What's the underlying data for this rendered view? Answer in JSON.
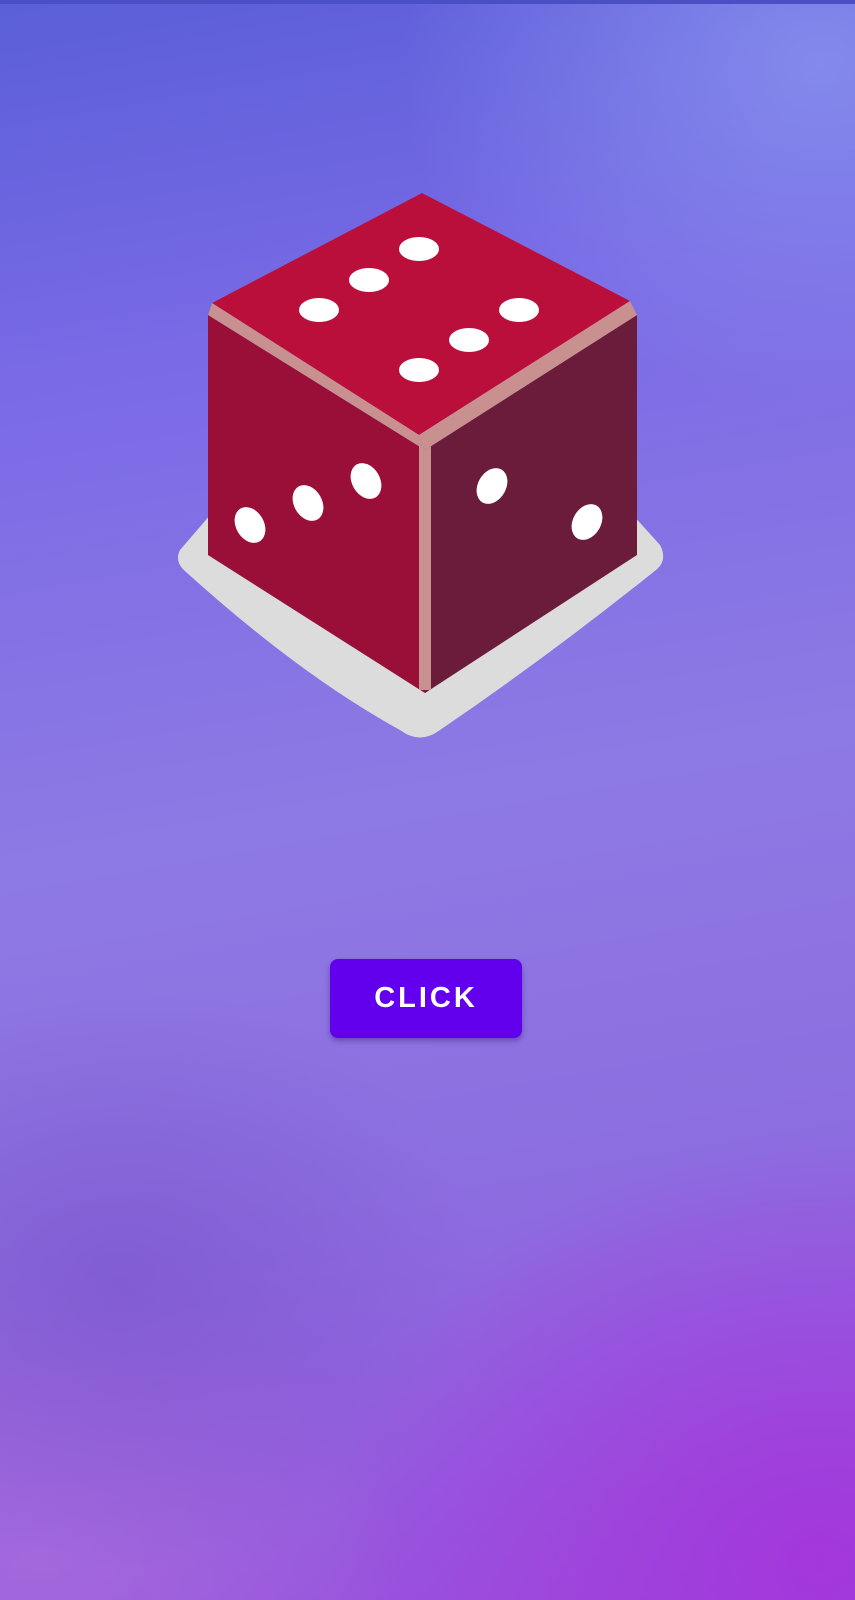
{
  "screen": {
    "background_colors": [
      "#5a5fd8",
      "#8e7ae4",
      "#a532dc"
    ]
  },
  "dice": {
    "icon": "dice-icon",
    "top_face_pips": 6,
    "front_face_pips": 3,
    "right_face_pips": 2,
    "colors": {
      "top": "#bb0f3b",
      "front": "#990f37",
      "right": "#6c1c3b",
      "edge": "#c99090",
      "pip": "#ffffff",
      "shadow": "#dcdcdc"
    }
  },
  "button": {
    "label": "CLICK",
    "color": "#6200ee"
  }
}
